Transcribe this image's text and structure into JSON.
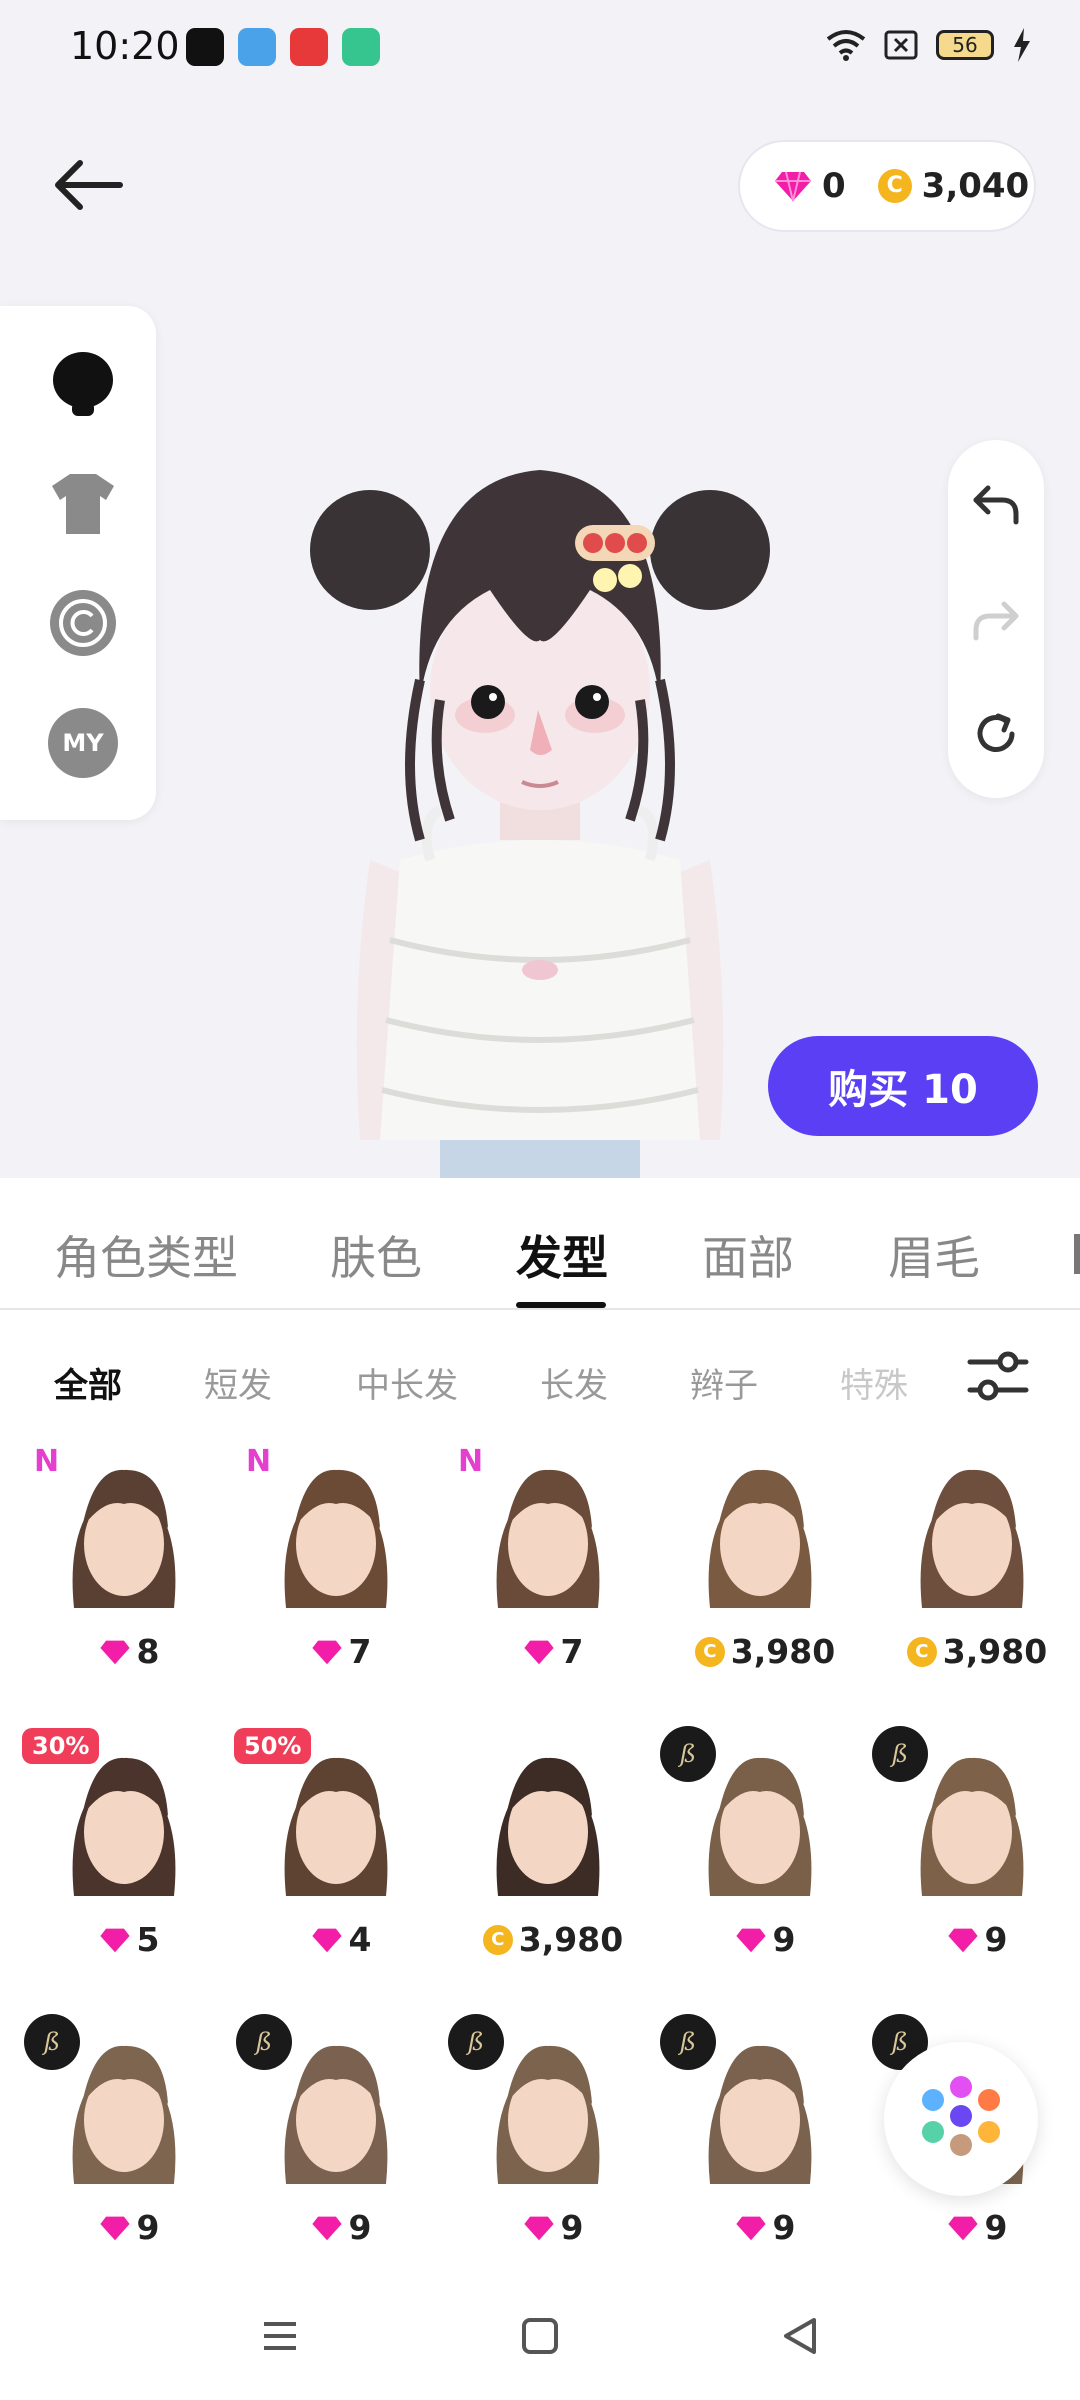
{
  "status_bar": {
    "time": "10:20",
    "battery": "56"
  },
  "currency": {
    "diamonds": "0",
    "coins": "3,040"
  },
  "buy_button": {
    "label": "购买 10"
  },
  "side_panel": {
    "my_label": "MY"
  },
  "tabs": [
    "角色类型",
    "肤色",
    "发型",
    "面部",
    "眉毛"
  ],
  "active_tab": "发型",
  "subtabs": [
    "全部",
    "短发",
    "中长发",
    "长发",
    "辫子",
    "特殊"
  ],
  "active_subtab": "全部",
  "colors": {
    "accent": "#5b3ff5",
    "diamond": "#f21ea8",
    "coin": "#f4b51f",
    "sale_badge": "#ef3d5a",
    "new_badge": "#e53fd0"
  },
  "items": [
    {
      "price": "8",
      "currency": "diamond",
      "badge": "N",
      "hair": "short-dark-brown"
    },
    {
      "price": "7",
      "currency": "diamond",
      "badge": "N",
      "hair": "bangs-bow"
    },
    {
      "price": "7",
      "currency": "diamond",
      "badge": "N",
      "hair": "short-wavy"
    },
    {
      "price": "3,980",
      "currency": "coin",
      "badge": "",
      "hair": "long-braid"
    },
    {
      "price": "3,980",
      "currency": "coin",
      "badge": "",
      "hair": "tied-back"
    },
    {
      "price": "5",
      "currency": "diamond",
      "badge": "30%",
      "hair": "high-ponytail"
    },
    {
      "price": "4",
      "currency": "diamond",
      "badge": "50%",
      "hair": "spiky-short"
    },
    {
      "price": "3,980",
      "currency": "coin",
      "badge": "",
      "hair": "bangs-braids"
    },
    {
      "price": "9",
      "currency": "diamond",
      "badge": "brand",
      "hair": "wavy-bob"
    },
    {
      "price": "9",
      "currency": "diamond",
      "badge": "brand",
      "hair": "wavy-medium"
    },
    {
      "price": "9",
      "currency": "diamond",
      "badge": "brand",
      "hair": "long-straight"
    },
    {
      "price": "9",
      "currency": "diamond",
      "badge": "brand",
      "hair": "long-side"
    },
    {
      "price": "9",
      "currency": "diamond",
      "badge": "brand",
      "hair": "long-lob"
    },
    {
      "price": "9",
      "currency": "diamond",
      "badge": "brand",
      "hair": "long-curl"
    },
    {
      "price": "9",
      "currency": "diamond",
      "badge": "brand",
      "hair": "long-layered"
    }
  ]
}
